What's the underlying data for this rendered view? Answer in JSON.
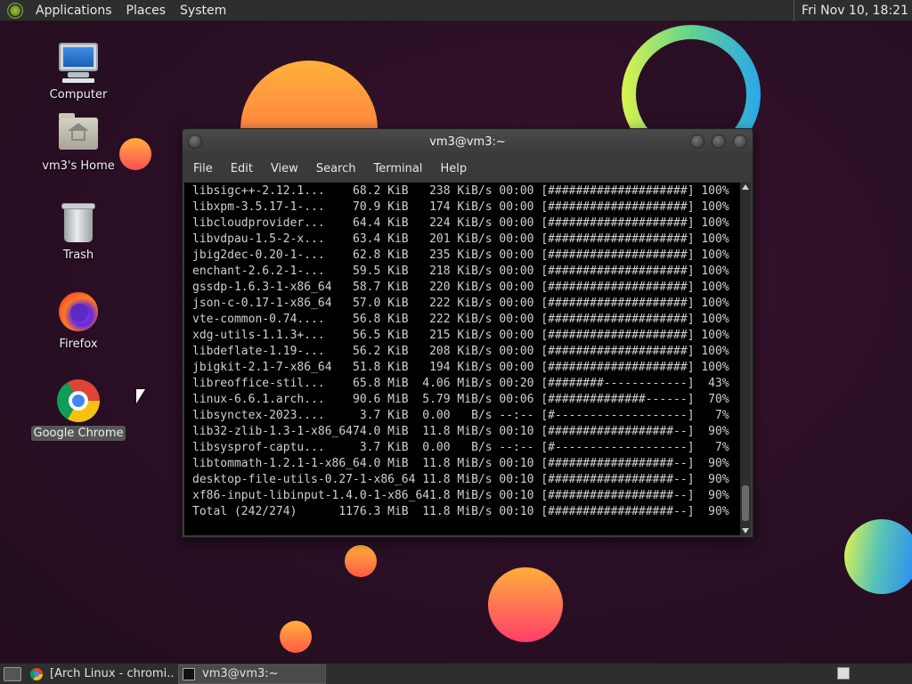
{
  "top_panel": {
    "menus": [
      "Applications",
      "Places",
      "System"
    ],
    "clock": "Fri Nov 10, 18:21"
  },
  "desktop": {
    "icons": [
      {
        "label": "Computer",
        "icon": "computer-icon"
      },
      {
        "label": "vm3's Home",
        "icon": "home-folder-icon"
      },
      {
        "label": "Trash",
        "icon": "trash-icon"
      },
      {
        "label": "Firefox",
        "icon": "firefox-icon"
      },
      {
        "label": "Google Chrome",
        "icon": "chrome-icon",
        "selected": true
      }
    ]
  },
  "terminal": {
    "title": "vm3@vm3:~",
    "menu": [
      "File",
      "Edit",
      "View",
      "Search",
      "Terminal",
      "Help"
    ],
    "lines": [
      "libsigc++-2.12.1...    68.2 KiB   238 KiB/s 00:00 [####################] 100%",
      "libxpm-3.5.17-1-...    70.9 KiB   174 KiB/s 00:00 [####################] 100%",
      "libcloudprovider...    64.4 KiB   224 KiB/s 00:00 [####################] 100%",
      "libvdpau-1.5-2-x...    63.4 KiB   201 KiB/s 00:00 [####################] 100%",
      "jbig2dec-0.20-1-...    62.8 KiB   235 KiB/s 00:00 [####################] 100%",
      "enchant-2.6.2-1-...    59.5 KiB   218 KiB/s 00:00 [####################] 100%",
      "gssdp-1.6.3-1-x86_64   58.7 KiB   220 KiB/s 00:00 [####################] 100%",
      "json-c-0.17-1-x86_64   57.0 KiB   222 KiB/s 00:00 [####################] 100%",
      "vte-common-0.74....    56.8 KiB   222 KiB/s 00:00 [####################] 100%",
      "xdg-utils-1.1.3+...    56.5 KiB   215 KiB/s 00:00 [####################] 100%",
      "libdeflate-1.19-...    56.2 KiB   208 KiB/s 00:00 [####################] 100%",
      "jbigkit-2.1-7-x86_64   51.8 KiB   194 KiB/s 00:00 [####################] 100%",
      "libreoffice-stil...    65.8 MiB  4.06 MiB/s 00:20 [########------------]  43%",
      "linux-6.6.1.arch...    90.6 MiB  5.79 MiB/s 00:06 [##############------]  70%",
      "libsynctex-2023....     3.7 KiB  0.00   B/s --:-- [#-------------------]   7%",
      "lib32-zlib-1.3-1-x86_6474.0 MiB  11.8 MiB/s 00:10 [##################--]  90%",
      "libsysprof-captu...     3.7 KiB  0.00   B/s --:-- [#-------------------]   7%",
      "libtommath-1.2.1-1-x86_64.0 MiB  11.8 MiB/s 00:10 [##################--]  90%",
      "desktop-file-utils-0.27-1-x86_64 11.8 MiB/s 00:10 [##################--]  90%",
      "xf86-input-libinput-1.4.0-1-x86_641.8 MiB/s 00:10 [##################--]  90%",
      "Total (242/274)      1176.3 MiB  11.8 MiB/s 00:10 [##################--]  90%"
    ]
  },
  "taskbar": {
    "tasks": [
      {
        "label": "[Arch Linux - chromi...",
        "icon": "chrome-icon",
        "active": false
      },
      {
        "label": "vm3@vm3:~",
        "icon": "terminal-icon",
        "active": true
      }
    ]
  }
}
